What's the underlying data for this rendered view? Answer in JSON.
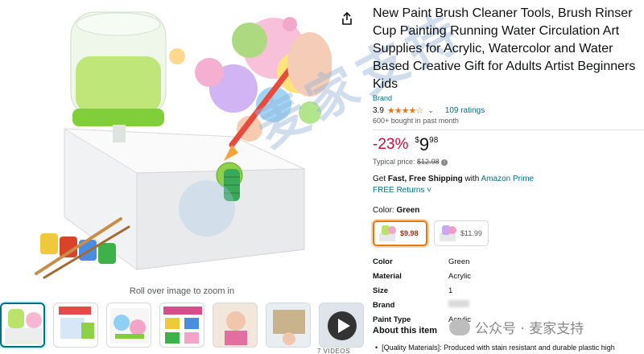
{
  "product": {
    "title": "New Paint Brush Cleaner Tools, Brush Rinser Cup Painting Running Water Circulation Art Supplies for Acrylic, Watercolor and Water Based Creative Gift for Adults Artist Beginners Kids",
    "brand": "Brand",
    "rating": "3.9",
    "stars": "★★★★☆",
    "ratings_count": "109 ratings",
    "bought": "600+ bought in past month",
    "discount": "-23%",
    "price_symbol": "$",
    "price_whole": "9",
    "price_fraction": "98",
    "typical_label": "Typical price:",
    "typical_price": "$12.98",
    "shipping_prefix": "Get",
    "shipping_bold": "Fast, Free Shipping",
    "shipping_with": "with",
    "shipping_link": "Amazon Prime",
    "free_returns": "FREE Returns ˅",
    "color_label": "Color:",
    "color_value": "Green",
    "swatches": [
      {
        "price": "$9.98"
      },
      {
        "price": "$11.99"
      }
    ],
    "specs": [
      {
        "key": "Color",
        "value": "Green"
      },
      {
        "key": "Material",
        "value": "Acrylic"
      },
      {
        "key": "Size",
        "value": "1"
      },
      {
        "key": "Brand",
        "value": ""
      },
      {
        "key": "Paint Type",
        "value": "Acrylic"
      }
    ],
    "about_heading": "About this item",
    "bullet_1": "[Quality Materials]: Produced with stain resistant and durable plastic high"
  },
  "gallery": {
    "zoom_hint": "Roll over image to zoom in",
    "videos_label": "7 VIDEOS"
  },
  "watermark": {
    "main_text": "麦家支持",
    "corner_text": "公众号 · 麦家支持"
  },
  "colors": {
    "link": "#007185",
    "discount": "#cc0c39",
    "star": "#de7921",
    "selected_border": "#e47911"
  }
}
